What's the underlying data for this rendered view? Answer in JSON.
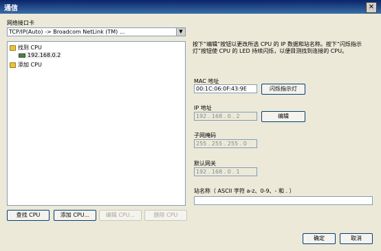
{
  "window": {
    "title": "通信",
    "close_label": "✕"
  },
  "network": {
    "label": "网络接口卡",
    "selected": "TCP/IP(Auto) -> Broadcom NetLink (TM) ..."
  },
  "tree": {
    "items": [
      {
        "label": "找到 CPU"
      },
      {
        "label": "192.168.0.2"
      },
      {
        "label": "添加 CPU"
      }
    ]
  },
  "buttons": {
    "find_cpu": "查找 CPU",
    "add_cpu": "添加 CPU...",
    "edit_cpu": "编辑 CPU...",
    "delete_cpu": "删除 CPU"
  },
  "details": {
    "description": "按下“编辑”按钮以更改所选 CPU 的 IP 数据和站名称。按下“闪烁指示灯”按钮使 CPU 的 LED 持续闪烁，以便目测找到连接的 CPU。",
    "mac_label": "MAC 地址",
    "mac_value": "00:1C:06:0F:43:9E",
    "flash_button": "闪烁指示灯",
    "ip_label": "IP 地址",
    "ip_value": "192 . 168 . 0 . 2",
    "edit_button": "编辑",
    "subnet_label": "子网掩码",
    "subnet_value": "255 . 255 . 255 . 0",
    "gateway_label": "默认网关",
    "gateway_value": "192 . 168 . 0 . 1",
    "station_label": "站名称（ ASCII 字符 a-z、0-9、- 和 . ）",
    "station_value": ""
  },
  "footer": {
    "ok_label": "确定",
    "cancel_label": "取消"
  }
}
